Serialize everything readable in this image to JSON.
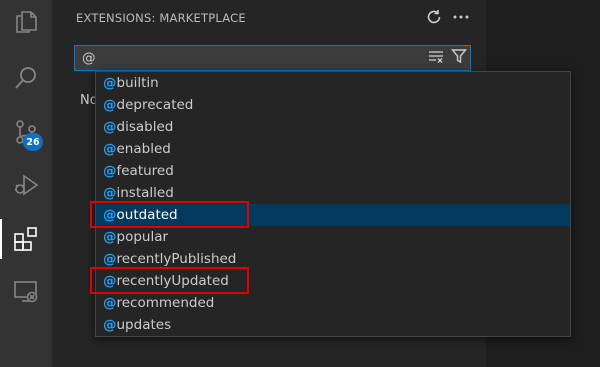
{
  "sidebar": {
    "title": "EXTENSIONS: MARKETPLACE",
    "actions": [
      {
        "name": "refresh",
        "icon": "refresh-icon"
      },
      {
        "name": "more",
        "icon": "more-icon"
      }
    ]
  },
  "activity_bar": {
    "items": [
      {
        "name": "explorer",
        "icon": "files-icon"
      },
      {
        "name": "search",
        "icon": "search-icon"
      },
      {
        "name": "source-control",
        "icon": "source-control-icon",
        "badge": "26"
      },
      {
        "name": "run-debug",
        "icon": "debug-icon"
      },
      {
        "name": "extensions",
        "icon": "extensions-icon",
        "active": true
      },
      {
        "name": "remote-explorer",
        "icon": "remote-explorer-icon"
      }
    ]
  },
  "search": {
    "value": "@",
    "clear_icon": "clear-filter-icon",
    "filter_icon": "filter-icon"
  },
  "no_results_partial": "No",
  "suggestions": {
    "prefix": "@",
    "items": [
      {
        "label": "builtin"
      },
      {
        "label": "deprecated"
      },
      {
        "label": "disabled"
      },
      {
        "label": "enabled"
      },
      {
        "label": "featured"
      },
      {
        "label": "installed"
      },
      {
        "label": "outdated",
        "selected": true,
        "highlighted": true
      },
      {
        "label": "popular"
      },
      {
        "label": "recentlyPublished"
      },
      {
        "label": "recentlyUpdated",
        "highlighted": true
      },
      {
        "label": "recommended"
      },
      {
        "label": "updates"
      }
    ]
  },
  "colors": {
    "accent": "#007fd4",
    "selection": "#04395e",
    "prefix": "#18a3ff",
    "highlight_box": "#e00000",
    "badge": "#0e70c0"
  }
}
